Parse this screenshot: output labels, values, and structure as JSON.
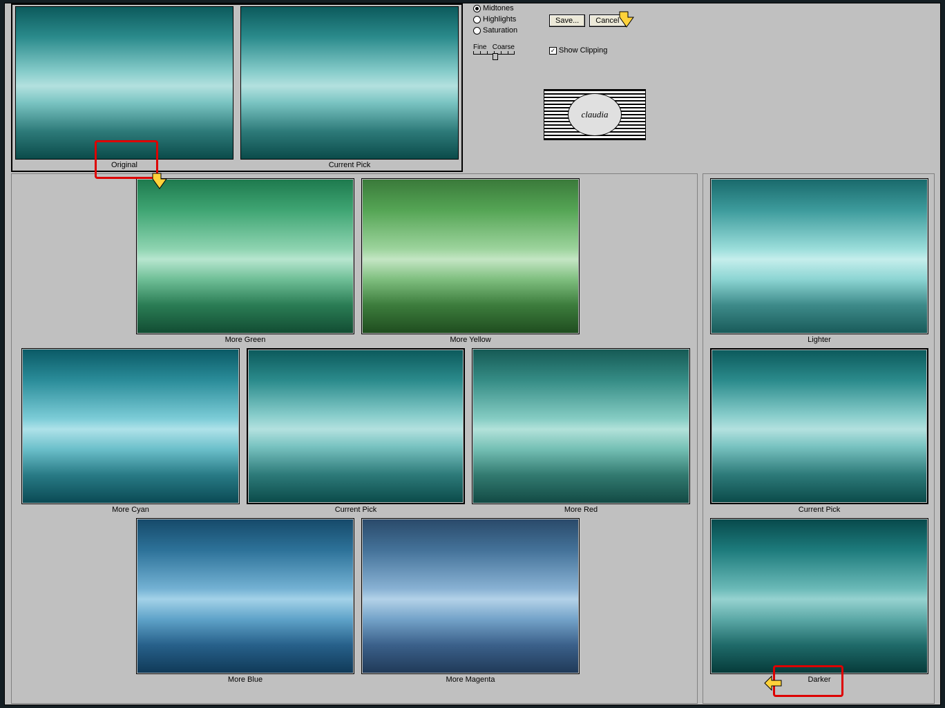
{
  "top": {
    "original_label": "Original",
    "current_label": "Current Pick"
  },
  "controls": {
    "radios": {
      "midtones": "Midtones",
      "highlights": "Highlights",
      "saturation": "Saturation"
    },
    "save_label": "Save...",
    "cancel_label": "Cancel",
    "fine_label": "Fine",
    "coarse_label": "Coarse",
    "show_clipping_label": "Show Clipping"
  },
  "logo_text": "claudia",
  "color_grid": {
    "more_green": "More Green",
    "more_yellow": "More Yellow",
    "more_cyan": "More Cyan",
    "current_pick": "Current Pick",
    "more_red": "More Red",
    "more_blue": "More Blue",
    "more_magenta": "More Magenta"
  },
  "brightness_col": {
    "lighter": "Lighter",
    "current_pick": "Current Pick",
    "darker": "Darker"
  }
}
